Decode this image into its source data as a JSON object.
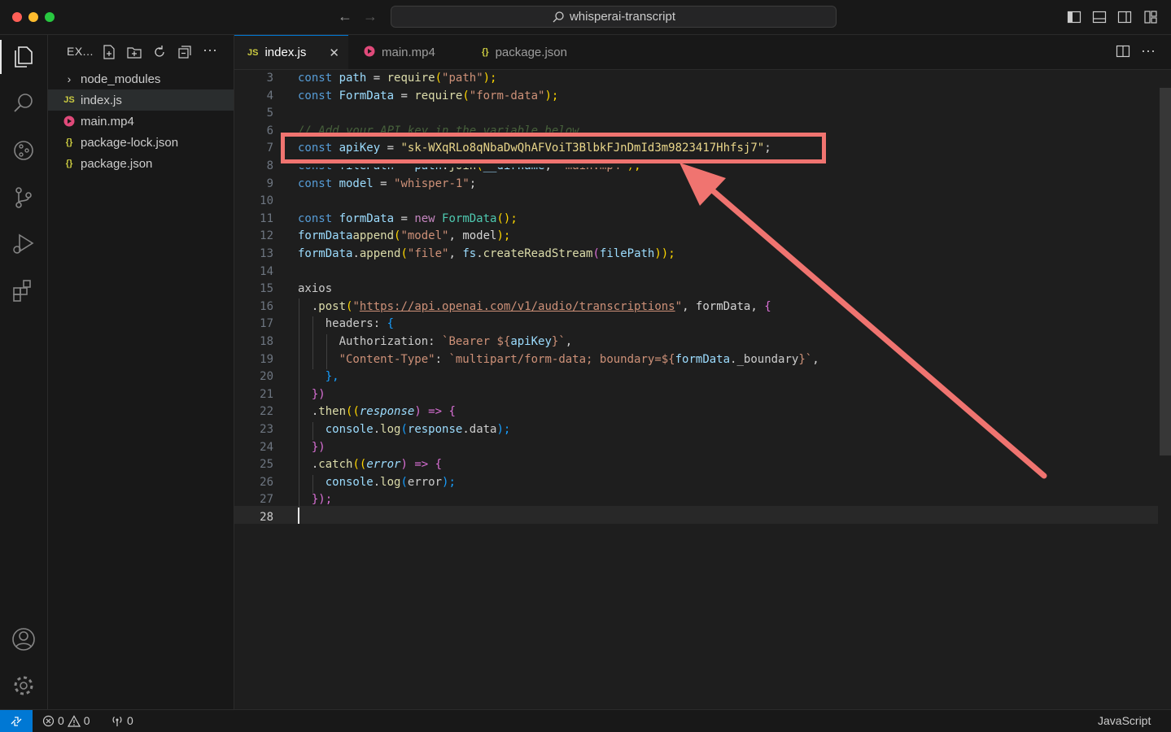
{
  "window": {
    "title": "whisperai-transcript"
  },
  "explorer": {
    "title": "EX...",
    "items": [
      {
        "label": "node_modules",
        "type": "folder"
      },
      {
        "label": "index.js",
        "type": "js",
        "selected": true
      },
      {
        "label": "main.mp4",
        "type": "media"
      },
      {
        "label": "package-lock.json",
        "type": "json"
      },
      {
        "label": "package.json",
        "type": "json"
      }
    ]
  },
  "tabs": [
    {
      "label": "index.js",
      "icon": "JS",
      "active": true
    },
    {
      "label": "main.mp4",
      "icon": "media"
    },
    {
      "label": "package.json",
      "icon": "{}"
    }
  ],
  "editor": {
    "line_numbers": [
      "3",
      "4",
      "5",
      "6",
      "7",
      "8",
      "9",
      "10",
      "11",
      "12",
      "13",
      "14",
      "15",
      "16",
      "17",
      "18",
      "19",
      "20",
      "21",
      "22",
      "23",
      "24",
      "25",
      "26",
      "27",
      "28"
    ],
    "current_line": "28",
    "code": {
      "l3": {
        "a": "const ",
        "b": "path",
        "c": " = ",
        "d": "require",
        "e": "(",
        "f": "\"path\"",
        "g": ");"
      },
      "l4": {
        "a": "const ",
        "b": "FormData",
        "c": " = ",
        "d": "require",
        "e": "(",
        "f": "\"form-data\"",
        "g": ");"
      },
      "l6": "// Add your API key in the variable below",
      "l7": {
        "a": "const ",
        "b": "apiKey",
        "c": " = ",
        "d": "\"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\"",
        "e": ";"
      },
      "l8": {
        "a": "const ",
        "b": "filePath",
        "c": " = ",
        "d": "path",
        "e": ".",
        "f": "join",
        "g": "(",
        "h": "__dirname",
        "i": ", ",
        "j": "\"main.mp4\"",
        "k": ");"
      },
      "l9": {
        "a": "const ",
        "b": "model",
        "c": " = ",
        "d": "\"whisper-1\"",
        "e": ";"
      },
      "l11": {
        "a": "const ",
        "b": "formData",
        "c": " = ",
        "d": "new ",
        "e": "FormData",
        "f": "();"
      },
      "l12": {
        "a": "formData",
        ".": ".",
        "b": "append",
        "c": "(",
        "d": "\"model\"",
        "e": ", model",
        ")": ");"
      },
      "l13": {
        "a": "formData",
        ".": ".",
        "b": "append",
        "c": "(",
        "d": "\"file\"",
        "e": ", ",
        "f": "fs",
        ".2": ".",
        "g": "createReadStream",
        "h": "(",
        "i": "filePath",
        "j": "));"
      },
      "l15": "axios",
      "l16": {
        "a": "  .",
        "b": "post",
        "c": "(",
        "d": "\"",
        "url": "https://api.openai.com/v1/audio/transcriptions",
        "e": "\"",
        ",": ", formData, ",
        "f": "{"
      },
      "l17": {
        "a": "    headers",
        ":": ": ",
        "b": "{"
      },
      "l18": {
        "a": "      Authorization",
        ":": ": ",
        "b": "`Bearer ${",
        "c": "apiKey",
        "d": "}`",
        ",": ","
      },
      "l19": {
        "a": "      ",
        "b": "\"Content-Type\"",
        ":": ": ",
        "c": "`multipart/form-data; boundary=${",
        "d": "formData",
        "e": "._boundary",
        "f": "}`",
        ",": ","
      },
      "l20": {
        "a": "    },"
      },
      "l21": {
        "a": "  })"
      },
      "l22": {
        "a": "  .",
        "b": "then",
        "c": "((",
        "d": "response",
        "e": ") => ",
        "f": "{"
      },
      "l23": {
        "a": "    console",
        ".": ".",
        "b": "log",
        "c": "(",
        "d": "response",
        ".2": ".",
        "e": "data",
        "f": ");"
      },
      "l24": {
        "a": "  })"
      },
      "l25": {
        "a": "  .",
        "b": "catch",
        "c": "((",
        "d": "error",
        "e": ") => ",
        "f": "{"
      },
      "l26": {
        "a": "    console",
        ".": ".",
        "b": "log",
        "c": "(",
        "d": "error",
        "e": ");"
      },
      "l27": {
        "a": "  });"
      }
    }
  },
  "statusbar": {
    "errors": "0",
    "warnings": "0",
    "ports": "0",
    "language": "JavaScript"
  },
  "colors": {
    "accent": "#0078d4",
    "highlight": "#f07470"
  }
}
